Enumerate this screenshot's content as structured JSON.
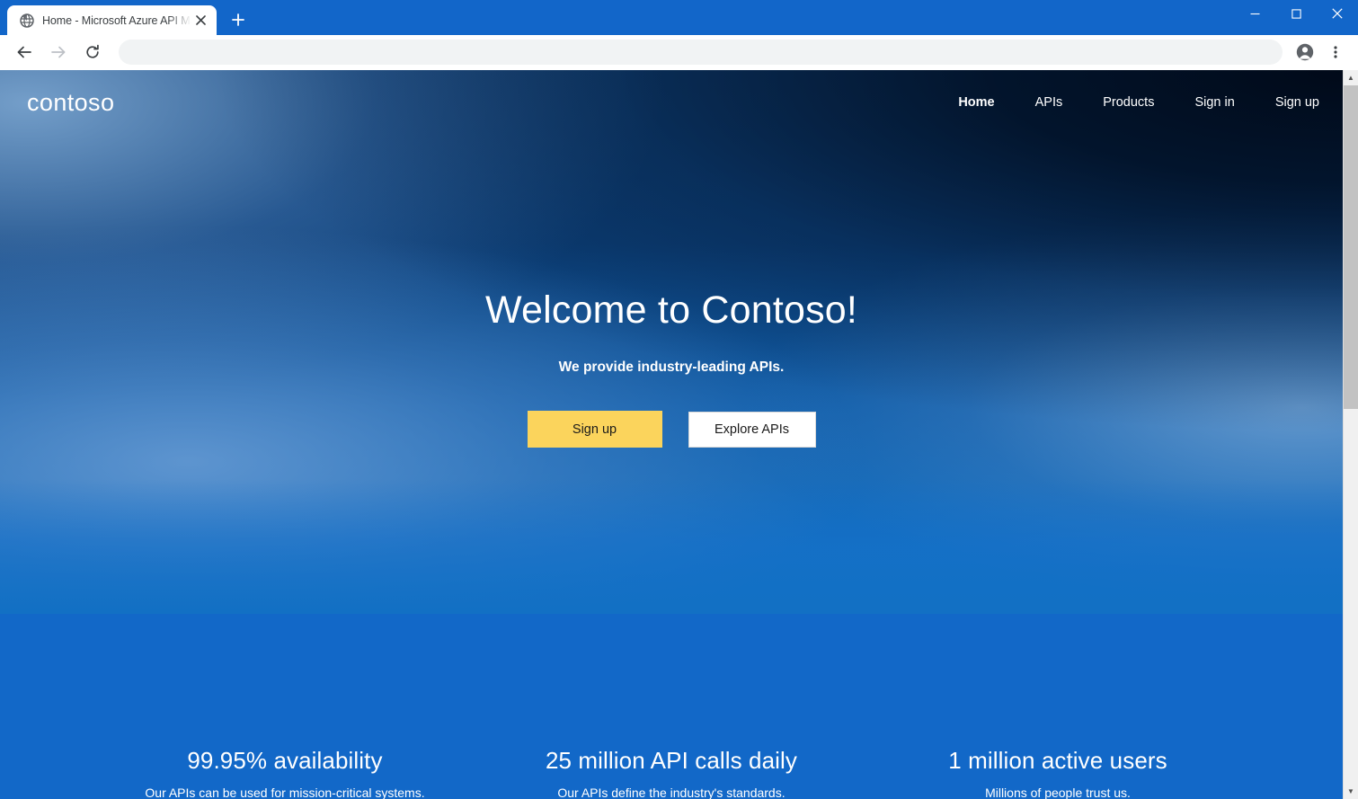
{
  "browser": {
    "tab": {
      "title": "Home - Microsoft Azure API Man",
      "favicon_name": "globe-icon",
      "close_label": "✕"
    },
    "newtab_label": "+",
    "window_controls": {
      "minimize": "─",
      "maximize": "☐",
      "close": "✕"
    },
    "toolbar": {
      "back_label": "←",
      "forward_label": "→",
      "reload_label": "↻",
      "address_value": "",
      "address_placeholder": "",
      "profile_label": "profile",
      "menu_label": "⋮"
    }
  },
  "site": {
    "brand": "contoso",
    "nav": [
      {
        "label": "Home",
        "active": true
      },
      {
        "label": "APIs",
        "active": false
      },
      {
        "label": "Products",
        "active": false
      },
      {
        "label": "Sign in",
        "active": false
      },
      {
        "label": "Sign up",
        "active": false
      }
    ],
    "hero": {
      "title": "Welcome to Contoso!",
      "subtitle": "We provide industry-leading APIs.",
      "primary_button": "Sign up",
      "secondary_button": "Explore APIs"
    },
    "stats": [
      {
        "value": "99.95% availability",
        "description": "Our APIs can be used for mission-critical systems."
      },
      {
        "value": "25 million API calls daily",
        "description": "Our APIs define the industry's standards."
      },
      {
        "value": "1 million active users",
        "description": "Millions of people trust us."
      }
    ],
    "colors": {
      "accent_yellow": "#fbd45c",
      "page_blue": "#1268c8",
      "browser_blue": "#1266c9",
      "dark_navy": "#00101f"
    }
  },
  "scrollbar": {
    "up_arrow": "▲",
    "down_arrow": "▼"
  }
}
